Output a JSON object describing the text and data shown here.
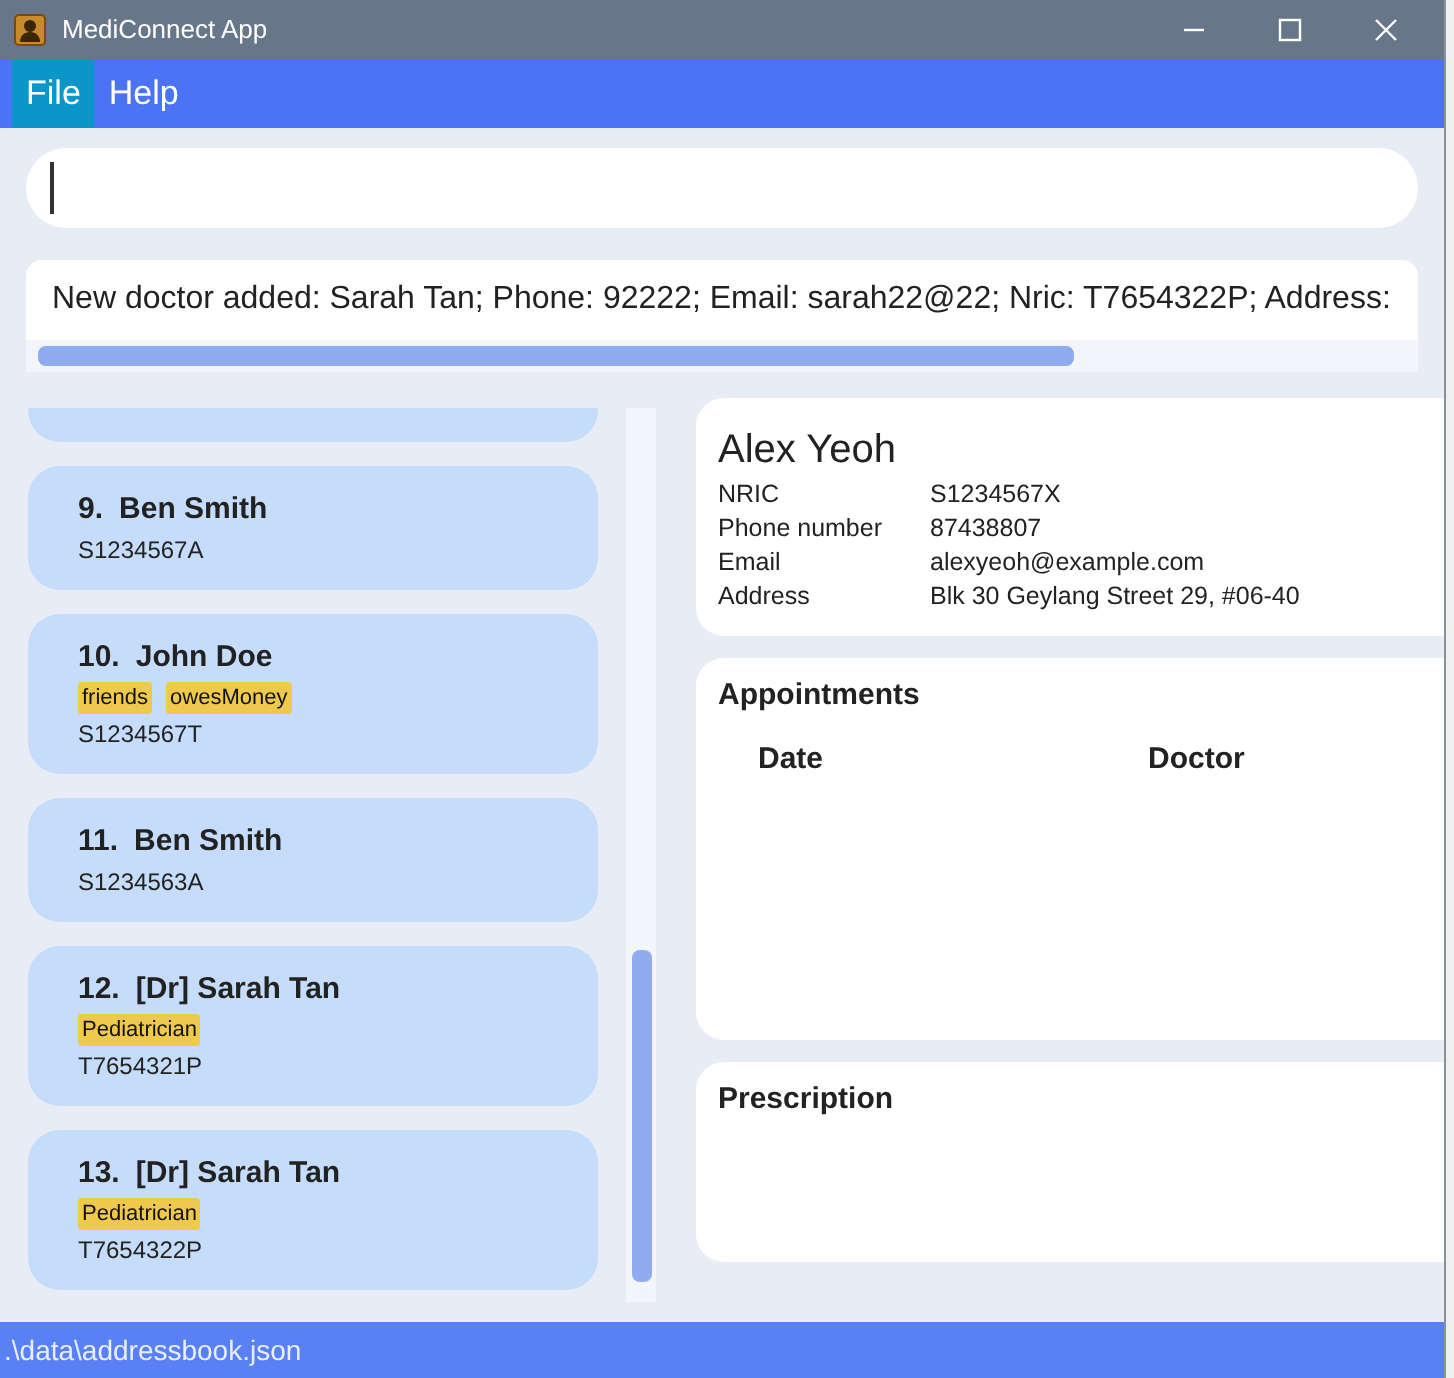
{
  "window": {
    "title": "MediConnect App"
  },
  "menu": [
    {
      "label": "File",
      "selected": true
    },
    {
      "label": "Help",
      "selected": false
    }
  ],
  "result_display": {
    "text": "New doctor added: Sarah Tan; Phone: 92222; Email: sarah22@22; Nric: T7654322P; Address:"
  },
  "person_list": [
    {
      "index": "9.",
      "name": "Ben Smith",
      "nric": "S1234567A"
    },
    {
      "index": "10.",
      "name": "John Doe",
      "tags": [
        "friends",
        "owesMoney"
      ],
      "nric": "S1234567T"
    },
    {
      "index": "11.",
      "name": "Ben Smith",
      "nric": "S1234563A"
    },
    {
      "index": "12.",
      "name": "[Dr] Sarah Tan",
      "tags": [
        "Pediatrician"
      ],
      "nric": "T7654321P"
    },
    {
      "index": "13.",
      "name": "[Dr] Sarah Tan",
      "tags": [
        "Pediatrician"
      ],
      "nric": "T7654322P"
    }
  ],
  "details": {
    "name": "Alex Yeoh",
    "fields": [
      {
        "label": "NRIC",
        "value": "S1234567X"
      },
      {
        "label": "Phone number",
        "value": "87438807"
      },
      {
        "label": "Email",
        "value": "alexyeoh@example.com"
      },
      {
        "label": "Address",
        "value": "Blk 30 Geylang Street 29, #06-40"
      }
    ]
  },
  "appointments": {
    "title": "Appointments",
    "columns": [
      "Date",
      "Doctor"
    ]
  },
  "prescription": {
    "title": "Prescription"
  },
  "status_bar": {
    "text": ".\\data\\addressbook.json"
  }
}
